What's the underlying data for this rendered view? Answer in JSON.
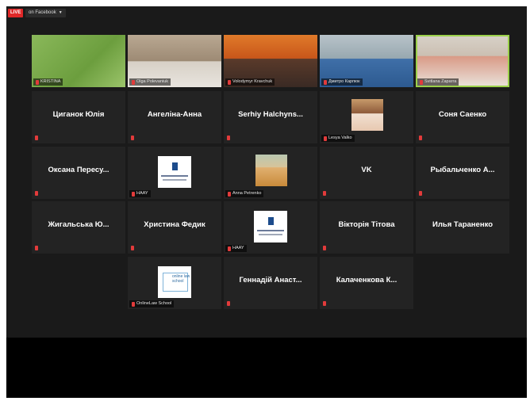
{
  "toolbar": {
    "live_label": "LIVE",
    "live_target": "on Facebook"
  },
  "tiles": [
    {
      "caption": "KRISTINA"
    },
    {
      "caption": "Olga Polevaniuk"
    },
    {
      "caption": "Volodymyr Kravchuk"
    },
    {
      "caption": "Дмитро Карпюк"
    },
    {
      "caption": "Svitlana Zaparra"
    },
    {
      "name": "Циганок Юлія"
    },
    {
      "name": "Ангеліна-Анна"
    },
    {
      "name": "Serhiy Halchyns..."
    },
    {
      "caption": "Lesya Valko"
    },
    {
      "name": "Соня Саенко"
    },
    {
      "name": "Оксана Пересу..."
    },
    {
      "caption": "HAAY"
    },
    {
      "caption": "Anna Petrenko"
    },
    {
      "name": "VK"
    },
    {
      "name": "Рыбальченко А..."
    },
    {
      "name": "Жигальська Ю..."
    },
    {
      "name": "Христина Федик"
    },
    {
      "caption": "HAAY"
    },
    {
      "name": "Вікторія Тітова"
    },
    {
      "name": "Илья Тараненко"
    },
    {
      "caption": "OnlineLaw School",
      "logo_text": "online law school"
    },
    {
      "name": "Геннадій Анаст..."
    },
    {
      "name": "Калаченкова К..."
    }
  ]
}
